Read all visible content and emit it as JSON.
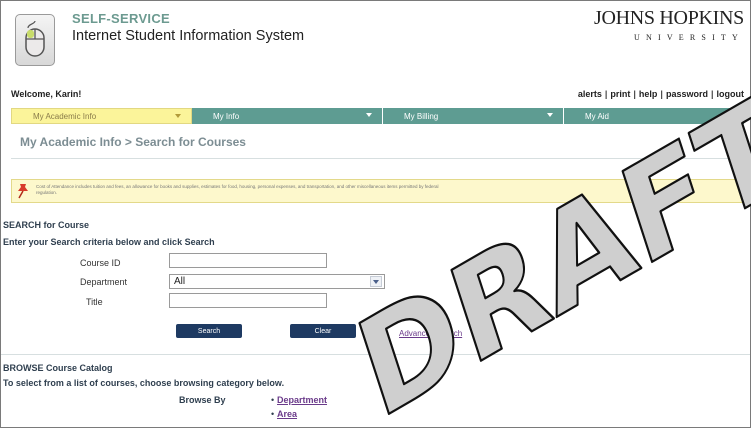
{
  "header": {
    "brand_top": "SELF-SERVICE",
    "brand_sub": "Internet Student Information System",
    "university_name": "JOHNS HOPKINS",
    "university_sub": "UNIVERSITY"
  },
  "welcome": "Welcome, Karin!",
  "toplinks": [
    "alerts",
    "print",
    "help",
    "password",
    "logout"
  ],
  "nav": {
    "tabs": [
      {
        "label": "My Academic Info",
        "active": true
      },
      {
        "label": "My Info",
        "active": false
      },
      {
        "label": "My Billing",
        "active": false
      },
      {
        "label": "My Aid",
        "active": false
      }
    ]
  },
  "breadcrumb": "My Academic Info > Search for Courses",
  "notice": {
    "text": "Cost of Attendance includes tuition and fees, an allowance for books and supplies, estimates for food, housing, personal expenses, and transportation, and other miscellaneous items permitted by federal regulation."
  },
  "search": {
    "title": "SEARCH for Course",
    "instructions": "Enter your Search criteria below and click Search",
    "course_id_label": "Course ID",
    "course_id_value": "",
    "department_label": "Department",
    "department_value": "All",
    "title_label": "Title",
    "title_value": "",
    "search_button": "Search",
    "clear_button": "Clear",
    "advanced_link": "Advanced Search"
  },
  "browse": {
    "title": "BROWSE Course Catalog",
    "instructions": "To select from a list of courses, choose browsing category below.",
    "browse_by_label": "Browse By",
    "links": [
      "Department",
      "Area"
    ]
  },
  "watermark": "DRAFT",
  "colors": {
    "nav_active": "#fbf49a",
    "nav_inactive": "#5e9c92",
    "button": "#1e3a62",
    "brand_accent": "#6c9a90",
    "link": "#6a3a8a",
    "notice_bg": "#fdf8cc"
  },
  "icons": {
    "logo": "mouse-icon",
    "notice": "pushpin-icon",
    "select": "chevron-down-icon"
  }
}
